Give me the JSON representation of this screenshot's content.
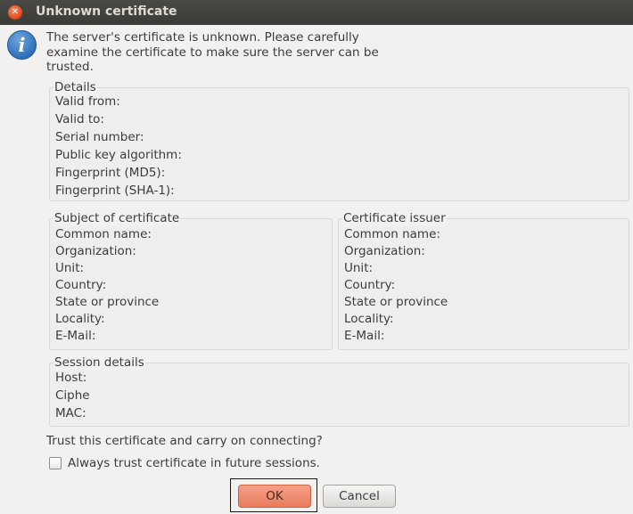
{
  "window": {
    "title": "Unknown certificate"
  },
  "icons": {
    "close": "close-icon",
    "info": "info-icon"
  },
  "message": "The server's certificate is unknown. Please carefully examine the certificate to make sure the server can be trusted.",
  "details": {
    "title": "Details",
    "rows": [
      "Valid from:",
      "Valid to:",
      "Serial number:",
      "Public key algorithm:",
      "Fingerprint (MD5):",
      "Fingerprint (SHA-1):"
    ]
  },
  "subject": {
    "title": "Subject of certificate",
    "rows": [
      "Common name:",
      "Organization:",
      "Unit:",
      "Country:",
      "State or province",
      "Locality:",
      "E-Mail:"
    ]
  },
  "issuer": {
    "title": "Certificate issuer",
    "rows": [
      "Common name:",
      "Organization:",
      "Unit:",
      "Country:",
      "State or province",
      "Locality:",
      "E-Mail:"
    ]
  },
  "session": {
    "title": "Session details",
    "rows": [
      "Host:",
      "Ciphe",
      "MAC:"
    ]
  },
  "trust_question": "Trust this certificate and carry on connecting?",
  "always_trust": {
    "label": "Always trust certificate in future sessions.",
    "checked": false
  },
  "buttons": {
    "ok": "OK",
    "cancel": "Cancel"
  },
  "colors": {
    "titlebar": "#3c3b37",
    "close": "#e2471d",
    "ok_button": "#ea7c5c",
    "background": "#f2f1f0"
  }
}
